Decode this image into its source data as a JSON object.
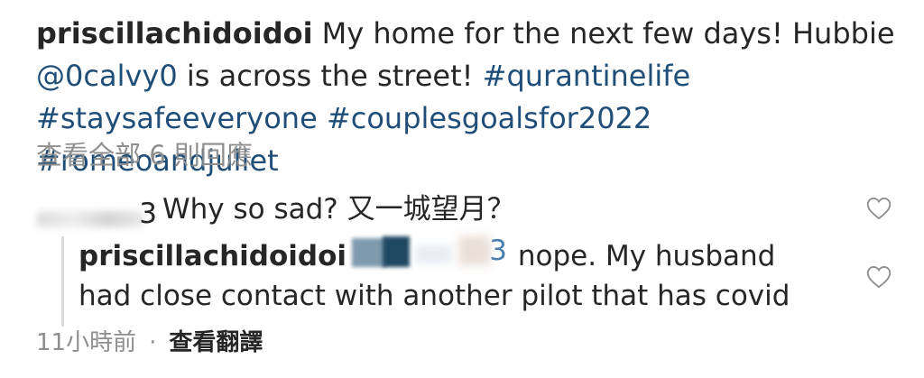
{
  "caption": {
    "username": "priscillachidoidoi",
    "text_before": "My home for the next few days! Hubbie ",
    "mention": "@0calvy0",
    "text_after": " is across the street! ",
    "hashtags": [
      "#qurantinelife",
      "#staysafeeveryone",
      "#couplesgoalsfor2022",
      "#romeoandjuliet"
    ]
  },
  "view_all_comments": "查看全部 6 則回應",
  "comment": {
    "username_tail": "3",
    "text": "Why so sad? 又一城望月？"
  },
  "reply": {
    "username": "priscillachidoidoi",
    "mention_tail": "3",
    "text": "nope. My husband had close contact with another pilot that has covid"
  },
  "meta": {
    "time": "11小時前",
    "separator": "·",
    "see_translation": "查看翻譯"
  },
  "icons": {
    "like": "heart-outline-icon"
  },
  "colors": {
    "link": "#1f4e79",
    "secondary_text": "#8e8e8e",
    "primary_text": "#262626"
  }
}
